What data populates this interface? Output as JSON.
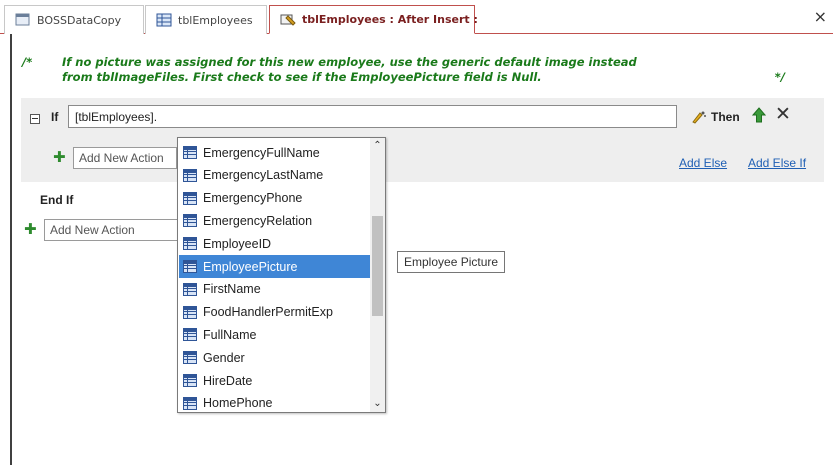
{
  "tabs": [
    {
      "label": "BOSSDataCopy",
      "icon": "database-icon",
      "active": false
    },
    {
      "label": "tblEmployees",
      "icon": "table-icon",
      "active": false
    },
    {
      "label": "tblEmployees : After Insert :",
      "icon": "macro-icon",
      "active": true
    }
  ],
  "window": {
    "close_glyph": "×"
  },
  "comment": {
    "open": "/*",
    "line1": "If no picture was assigned for this new employee, use the generic default image instead",
    "line2": "from tblImageFiles. First check to see if the EmployeePicture field is Null.",
    "close": "*/",
    "color": "#1a7a1a"
  },
  "if_block": {
    "keyword": "If",
    "condition_value": "[tblEmployees].",
    "then_label": "Then",
    "add_action_placeholder": "Add New Action",
    "add_else": "Add Else",
    "add_else_if": "Add Else If"
  },
  "end_if": "End If",
  "outer_action_placeholder": "Add New Action",
  "dropdown": {
    "items": [
      "EmergencyFullName",
      "EmergencyLastName",
      "EmergencyPhone",
      "EmergencyRelation",
      "EmployeeID",
      "EmployeePicture",
      "FirstName",
      "FoodHandlerPermitExp",
      "FullName",
      "Gender",
      "HireDate",
      "HomePhone"
    ],
    "selected": "EmployeePicture",
    "selected_color": "#3f86d6",
    "scroll_position": 0.35
  },
  "tooltip": "Employee Picture"
}
